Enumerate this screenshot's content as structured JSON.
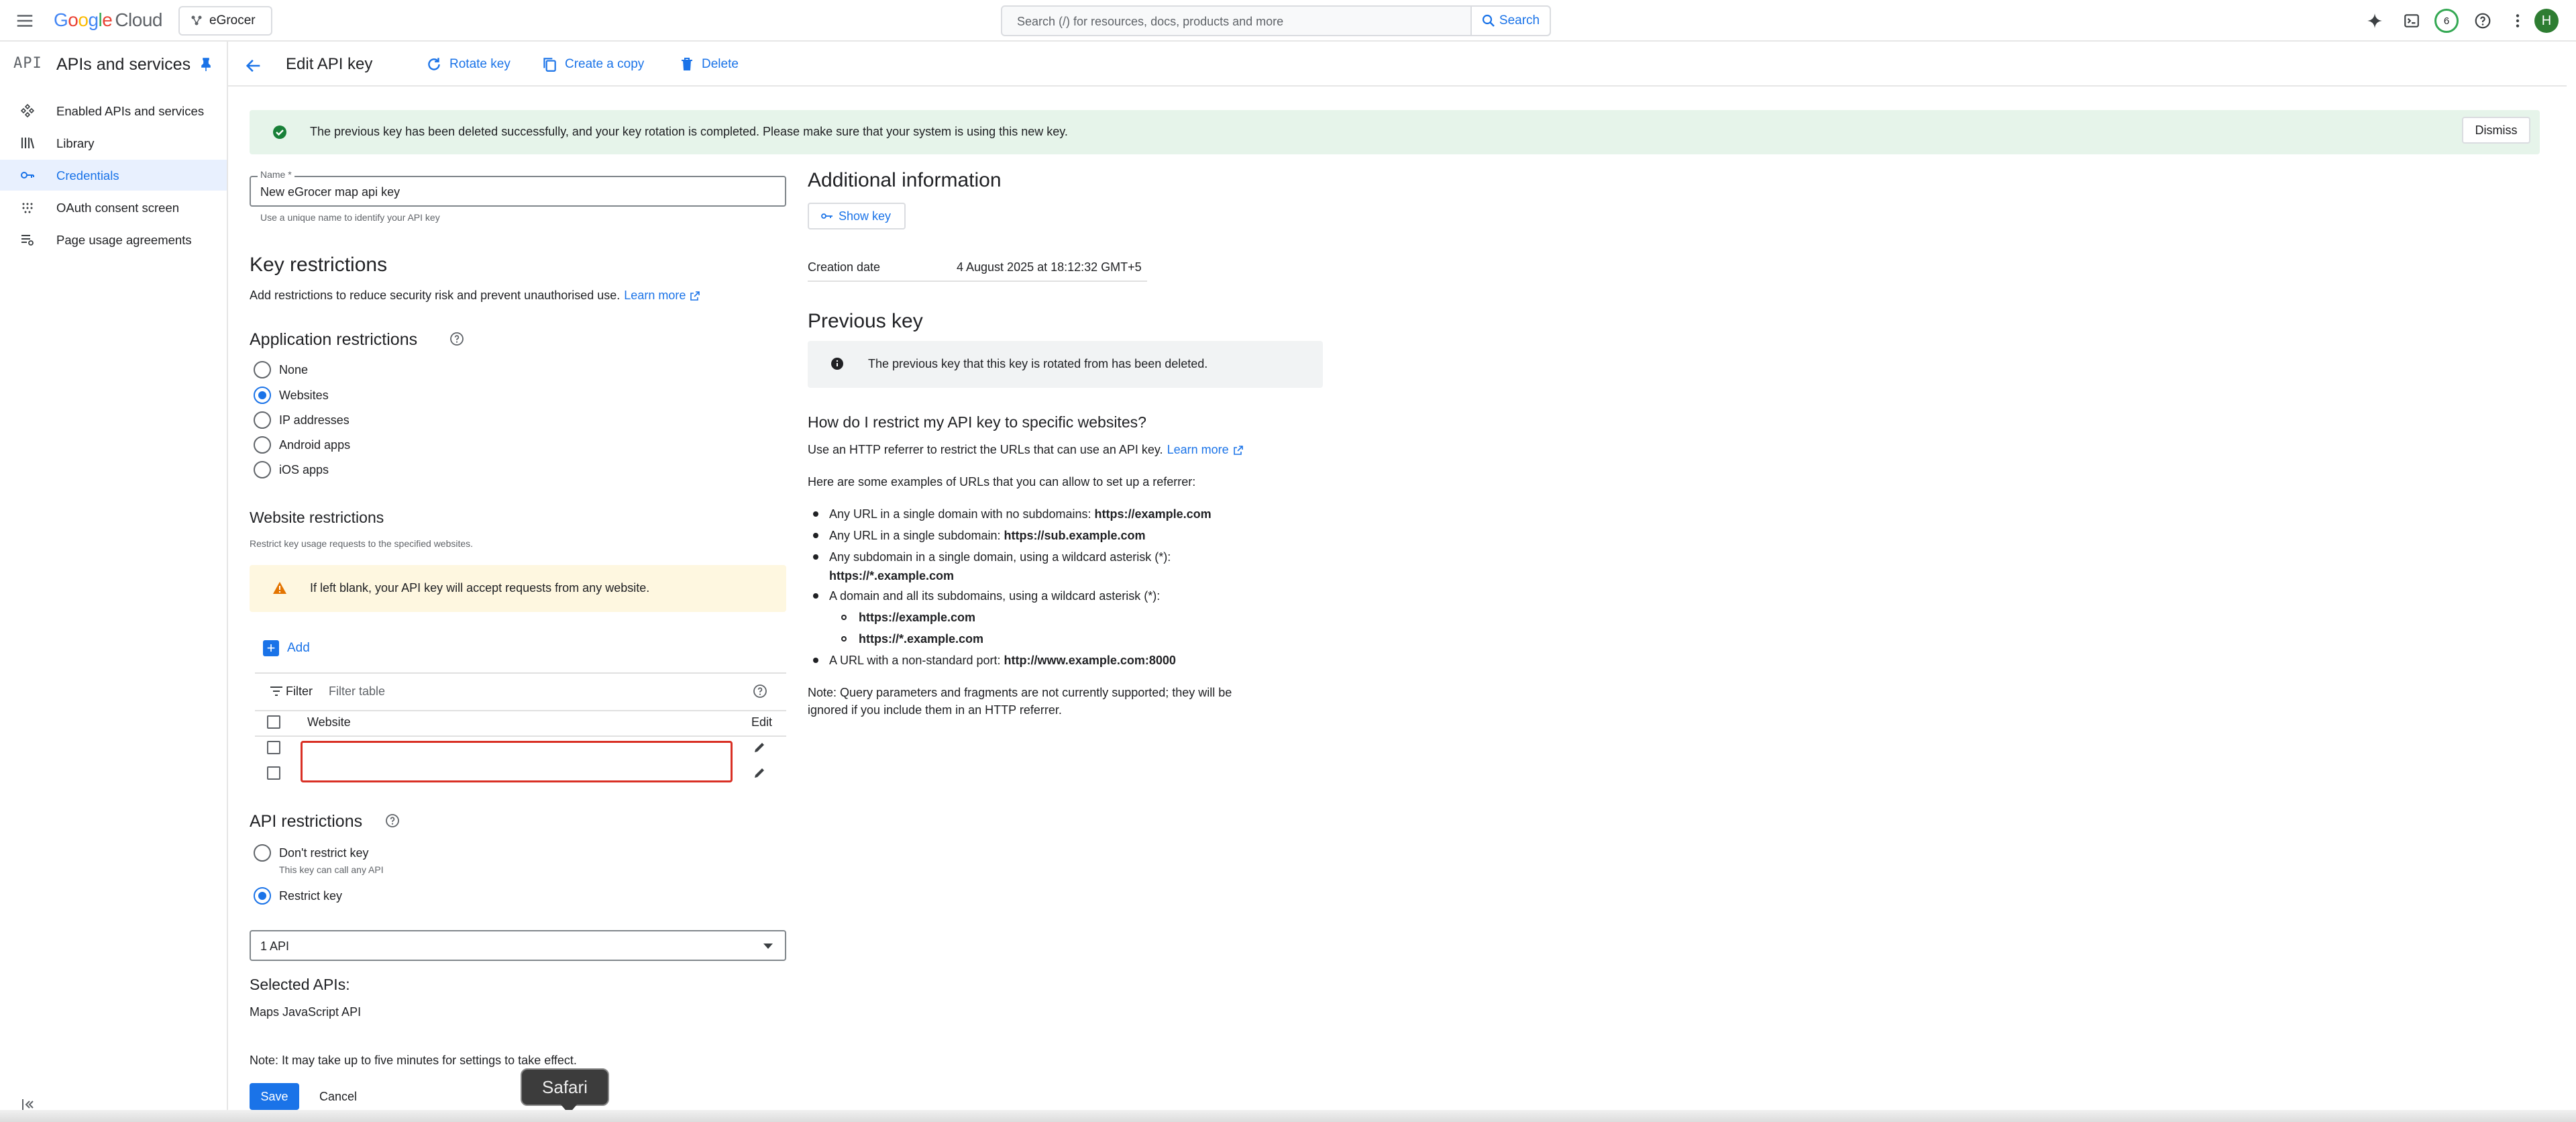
{
  "topbar": {
    "logo_google": "Google",
    "logo_cloud": "Cloud",
    "project": "eGrocer",
    "search_placeholder": "Search (/) for resources, docs, products and more",
    "search_button": "Search",
    "notifications_count": "6",
    "avatar_initial": "H"
  },
  "sidebar": {
    "api_label": "API",
    "title": "APIs and services",
    "items": [
      {
        "label": "Enabled APIs and services",
        "icon": "api-hub-icon"
      },
      {
        "label": "Library",
        "icon": "library-icon"
      },
      {
        "label": "Credentials",
        "icon": "key-icon",
        "active": true
      },
      {
        "label": "OAuth consent screen",
        "icon": "oauth-icon"
      },
      {
        "label": "Page usage agreements",
        "icon": "settings-list-icon"
      }
    ]
  },
  "header": {
    "title": "Edit API key",
    "rotate": "Rotate key",
    "copy": "Create a copy",
    "delete": "Delete"
  },
  "banner": {
    "text": "The previous key has been deleted successfully, and your key rotation is completed. Please make sure that your system is using this new key.",
    "dismiss": "Dismiss",
    "color": "#e6f4ea"
  },
  "form": {
    "name_label": "Name *",
    "name_value": "New eGrocer map api key",
    "name_hint": "Use a unique name to identify your API key",
    "key_restrictions_title": "Key restrictions",
    "key_restrictions_desc": "Add restrictions to reduce security risk and prevent unauthorised use.",
    "learn_more": "Learn more",
    "app_restrictions_title": "Application restrictions",
    "app_options": [
      "None",
      "Websites",
      "IP addresses",
      "Android apps",
      "iOS apps"
    ],
    "app_selected": "Websites",
    "website_restrictions_title": "Website restrictions",
    "website_restrictions_desc": "Restrict key usage requests to the specified websites.",
    "warning": "If left blank, your API key will accept requests from any website.",
    "add_label": "Add",
    "filter_label": "Filter",
    "filter_placeholder": "Filter table",
    "col_website": "Website",
    "col_edit": "Edit",
    "api_restrictions_title": "API restrictions",
    "dont_restrict": "Don't restrict key",
    "dont_restrict_hint": "This key can call any API",
    "restrict": "Restrict key",
    "select_value": "1 API",
    "selected_apis_title": "Selected APIs:",
    "selected_api": "Maps JavaScript API",
    "note": "Note: It may take up to five minutes for settings to take effect.",
    "save": "Save",
    "cancel": "Cancel"
  },
  "right": {
    "additional_title": "Additional information",
    "show_key": "Show key",
    "creation_label": "Creation date",
    "creation_value": "4 August 2025 at 18:12:32 GMT+5",
    "previous_title": "Previous key",
    "previous_info": "The previous key that this key is rotated from has been deleted.",
    "howto_title": "How do I restrict my API key to specific websites?",
    "howto_desc": "Use an HTTP referrer to restrict the URLs that can use an API key.",
    "learn_more": "Learn more",
    "examples_intro": "Here are some examples of URLs that you can allow to set up a referrer:",
    "ex1_text": "Any URL in a single domain with no subdomains: ",
    "ex1_url": "https://example.com",
    "ex2_text": "Any URL in a single subdomain: ",
    "ex2_url": "https://sub.example.com",
    "ex3_text": "Any subdomain in a single domain, using a wildcard asterisk (*):",
    "ex3_url": "https://*.example.com",
    "ex4_text": "A domain and all its subdomains, using a wildcard asterisk (*):",
    "ex4_sub1": "https://example.com",
    "ex4_sub2": "https://*.example.com",
    "ex5_text": "A URL with a non-standard port: ",
    "ex5_url": "http://www.example.com:8000",
    "note_line1": "Note: Query parameters and fragments are not currently supported; they will be",
    "note_line2": "ignored if you include them in an HTTP referrer."
  },
  "dock_tooltip": "Safari",
  "colors": {
    "accent": "#1a73e8",
    "error": "#d93025",
    "success": "#34a853"
  }
}
